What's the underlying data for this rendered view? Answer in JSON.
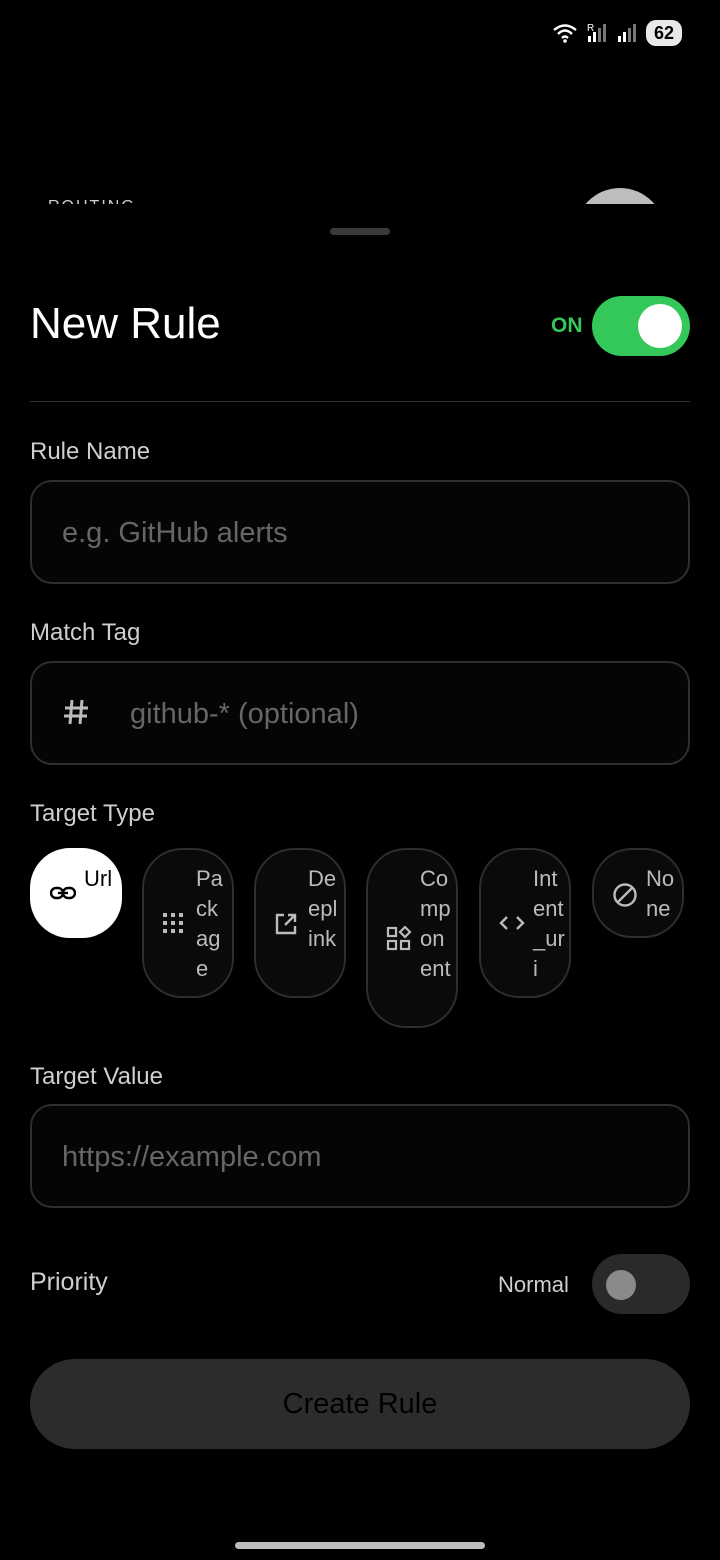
{
  "status_bar": {
    "battery": "62"
  },
  "sheet": {
    "title": "New Rule",
    "enabled_label": "ON",
    "enabled": true
  },
  "rule_name": {
    "label": "Rule Name",
    "placeholder": "e.g. GitHub alerts"
  },
  "match_tag": {
    "label": "Match Tag",
    "placeholder": "github-* (optional)",
    "icon": "hash-icon"
  },
  "target_type": {
    "label": "Target Type",
    "options": [
      {
        "label": "Url",
        "icon": "link-icon",
        "selected": true
      },
      {
        "label": "Package",
        "icon": "grid-icon",
        "selected": false
      },
      {
        "label": "Deeplink",
        "icon": "open-external-icon",
        "selected": false
      },
      {
        "label": "Component",
        "icon": "widgets-icon",
        "selected": false
      },
      {
        "label": "Intent_uri",
        "icon": "code-icon",
        "selected": false
      },
      {
        "label": "None",
        "icon": "block-icon",
        "selected": false
      }
    ]
  },
  "target_value": {
    "label": "Target Value",
    "placeholder": "https://example.com"
  },
  "priority": {
    "label": "Priority",
    "value_label": "Normal",
    "high": false
  },
  "actions": {
    "create_label": "Create Rule"
  },
  "colors": {
    "accent": "#34c759",
    "background": "#000000"
  }
}
